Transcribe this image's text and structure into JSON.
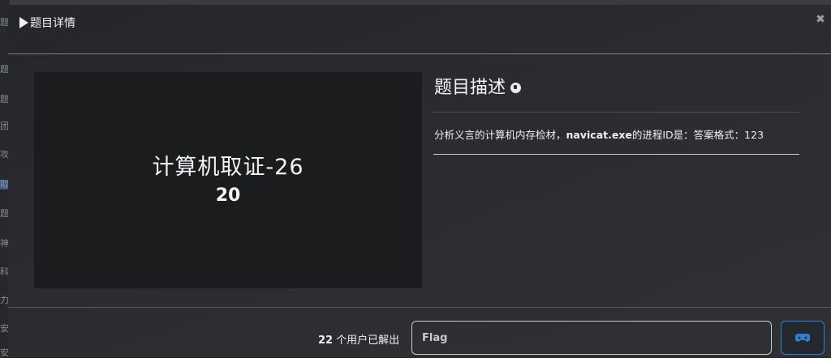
{
  "modal": {
    "title": "题目详情"
  },
  "challenge": {
    "name_line1": "计算机取证-26",
    "name_line2": "20"
  },
  "description": {
    "heading": "题目描述",
    "text_prefix": "分析义言的计算机内存检材，",
    "text_bold": "navicat.exe",
    "text_suffix": "的进程ID是：答案格式：123"
  },
  "footer": {
    "solved_number": "22",
    "solved_label": "个用户已解出",
    "flag_placeholder": "Flag"
  },
  "background": {
    "left_strip_chars": [
      "题",
      "题",
      "题",
      "团",
      "攻",
      "取",
      "题",
      "神",
      "科",
      "力",
      "安",
      "安"
    ]
  },
  "colors": {
    "accent": "#2f7fd6",
    "modal_bg": "#2a2c30",
    "card_bg": "#1b1c1e"
  },
  "icons": {
    "title": "play-icon",
    "close": "close-icon",
    "description": "pawn-icon",
    "submit": "gamepad-icon"
  }
}
